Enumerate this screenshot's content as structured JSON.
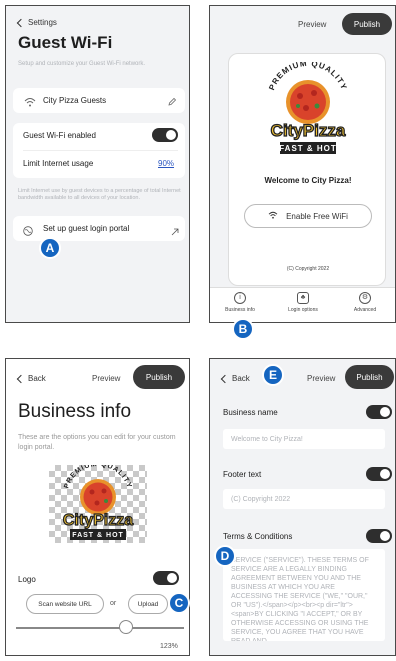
{
  "panel1": {
    "back_label": "Settings",
    "title": "Guest Wi-Fi",
    "subtitle": "Setup and customize your Guest Wi-Fi network.",
    "network_name": "City Pizza Guests",
    "enabled_label": "Guest Wi-Fi enabled",
    "limit_label": "Limit Internet usage",
    "limit_value": "90%",
    "note": "Limit Internet use by guest devices to a percentage of total Internet bandwidth available to all devices of your location.",
    "portal_label": "Set up guest login portal",
    "marker": "A"
  },
  "panel2": {
    "preview_label": "Preview",
    "publish_label": "Publish",
    "logo_top": "PREMIUM QUALITY",
    "logo_main": "CityPizza",
    "logo_bottom": "FAST & HOT",
    "welcome": "Welcome to City Pizza!",
    "wifi_button": "Enable Free WiFi",
    "copyright": "(C) Copyright 2022",
    "tabs": [
      {
        "label": "Business info"
      },
      {
        "label": "Login options"
      },
      {
        "label": "Advanced"
      }
    ],
    "marker": "B"
  },
  "panel3": {
    "back_label": "Back",
    "preview_label": "Preview",
    "publish_label": "Publish",
    "title": "Business info",
    "subtitle": "These are the options you can edit for your custom login portal.",
    "logo_top": "PREMIUM QUALITY",
    "logo_main": "CityPizza",
    "logo_bottom": "FAST & HOT",
    "logo_label": "Logo",
    "scan_button": "Scan website URL",
    "or_label": "or",
    "upload_button": "Upload",
    "zoom_value": "123%",
    "marker": "C"
  },
  "panel4": {
    "back_label": "Back",
    "preview_label": "Preview",
    "publish_label": "Publish",
    "business_name_label": "Business name",
    "business_name_value": "Welcome to City Pizza!",
    "footer_label": "Footer text",
    "footer_value": "(C) Copyright 2022",
    "terms_label": "Terms & Conditions",
    "terms_text": "SERVICE (\"SERVICE\"). THESE TERMS OF SERVICE ARE A LEGALLY BINDING AGREEMENT BETWEEN YOU AND THE BUSINESS AT WHICH YOU ARE ACCESSING THE SERVICE (\"WE,\" \"OUR,\" OR \"US\").</span></p><br><p dir=\"ltr\"><span>BY CLICKING \"I ACCEPT,\" OR BY OTHERWISE ACCESSING OR USING THE SERVICE, YOU AGREE THAT YOU HAVE READ AND",
    "marker_e": "E",
    "marker_d": "D"
  },
  "colors": {
    "marker_blue": "#1565c0",
    "publish_dark": "#3a3a3a",
    "toggle_on": "#2e2e2e",
    "link_blue": "#2a55c0"
  }
}
